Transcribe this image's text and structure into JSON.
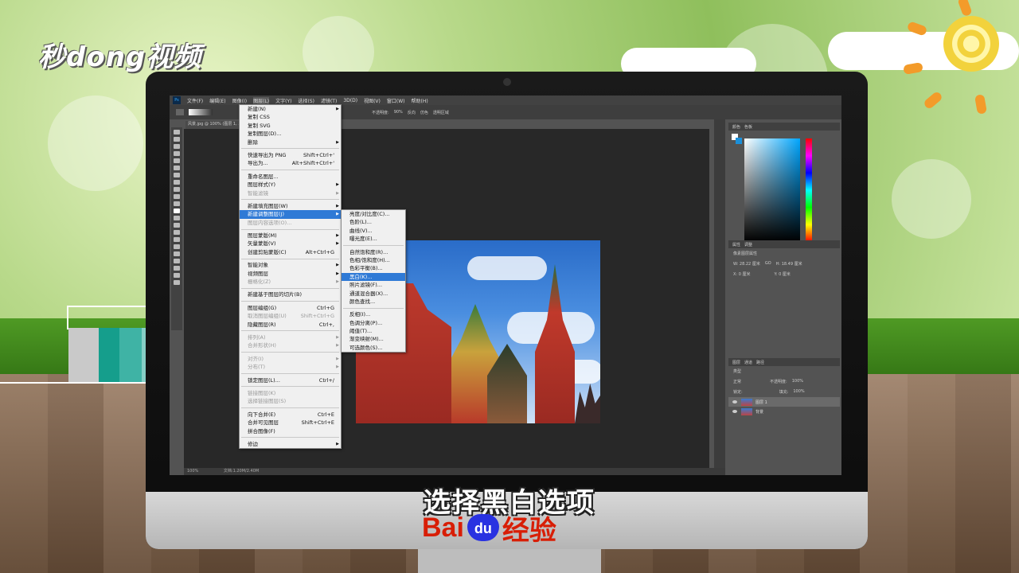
{
  "watermark": {
    "brand": "秒dong视频"
  },
  "caption": "选择黑白选项",
  "footer_logo": {
    "left": "Bai",
    "paw": "du",
    "right": "经验"
  },
  "colors": {
    "accent_blue": "#2f7ad6",
    "baidu_red": "#d81e06",
    "baidu_blue": "#2932e1",
    "teal": "#159e8c"
  },
  "ps": {
    "menubar": [
      "文件(F)",
      "编辑(E)",
      "图像(I)",
      "图层(L)",
      "文字(Y)",
      "选择(S)",
      "滤镜(T)",
      "3D(D)",
      "视图(V)",
      "窗口(W)",
      "帮助(H)"
    ],
    "options": {
      "opacity_label": "不透明度:",
      "opacity": "90%",
      "reverse": "反向",
      "dither": "仿色",
      "transparency": "透明区域"
    },
    "doc_tab": "风景.jpg @ 100% (图层 1, ...",
    "status": {
      "zoom": "100%",
      "doc": "文档:1.20M/2.40M"
    },
    "color_panel": {
      "tab1": "颜色",
      "tab2": "色板"
    },
    "props_panel": {
      "tab1": "属性",
      "tab2": "调整",
      "title": "像素图层属性",
      "w": "W: 28.22 厘米",
      "go": "GO",
      "h": "H: 18.49 厘米",
      "x": "X: 0 厘米",
      "y": "Y: 0 厘米"
    },
    "layers_panel": {
      "tabs": [
        "图层",
        "通道",
        "路径"
      ],
      "kind": "类型",
      "blend": "正常",
      "opacity_label": "不透明度:",
      "opacity": "100%",
      "lock_label": "锁定:",
      "fill_label": "填充:",
      "fill": "100%",
      "layers": [
        {
          "name": "图层 1",
          "selected": true
        },
        {
          "name": "背景",
          "selected": false
        }
      ]
    }
  },
  "layer_menu": [
    {
      "label": "新建(N)",
      "arrow": true
    },
    {
      "label": "复制 CSS"
    },
    {
      "label": "复制 SVG"
    },
    {
      "label": "复制图层(D)..."
    },
    {
      "label": "删除",
      "arrow": true
    },
    {
      "sep": true
    },
    {
      "label": "快速导出为 PNG",
      "shortcut": "Shift+Ctrl+'"
    },
    {
      "label": "导出为...",
      "shortcut": "Alt+Shift+Ctrl+'"
    },
    {
      "sep": true
    },
    {
      "label": "重命名图层..."
    },
    {
      "label": "图层样式(Y)",
      "arrow": true
    },
    {
      "label": "智能滤镜",
      "arrow": true,
      "disabled": true
    },
    {
      "sep": true
    },
    {
      "label": "新建填充图层(W)",
      "arrow": true
    },
    {
      "label": "新建调整图层(J)",
      "arrow": true,
      "highlight": true
    },
    {
      "label": "图层内容选项(O)...",
      "disabled": true
    },
    {
      "sep": true
    },
    {
      "label": "图层蒙版(M)",
      "arrow": true
    },
    {
      "label": "矢量蒙版(V)",
      "arrow": true
    },
    {
      "label": "创建剪贴蒙版(C)",
      "shortcut": "Alt+Ctrl+G"
    },
    {
      "sep": true
    },
    {
      "label": "智能对象",
      "arrow": true
    },
    {
      "label": "视频图层",
      "arrow": true
    },
    {
      "label": "栅格化(Z)",
      "arrow": true,
      "disabled": true
    },
    {
      "sep": true
    },
    {
      "label": "新建基于图层的切片(B)"
    },
    {
      "sep": true
    },
    {
      "label": "图层编组(G)",
      "shortcut": "Ctrl+G"
    },
    {
      "label": "取消图层编组(U)",
      "shortcut": "Shift+Ctrl+G",
      "disabled": true
    },
    {
      "label": "隐藏图层(R)",
      "shortcut": "Ctrl+,"
    },
    {
      "sep": true
    },
    {
      "label": "排列(A)",
      "arrow": true,
      "disabled": true
    },
    {
      "label": "合并形状(H)",
      "arrow": true,
      "disabled": true
    },
    {
      "sep": true
    },
    {
      "label": "对齐(I)",
      "arrow": true,
      "disabled": true
    },
    {
      "label": "分布(T)",
      "arrow": true,
      "disabled": true
    },
    {
      "sep": true
    },
    {
      "label": "锁定图层(L)...",
      "shortcut": "Ctrl+/"
    },
    {
      "sep": true
    },
    {
      "label": "链接图层(K)",
      "disabled": true
    },
    {
      "label": "选择链接图层(S)",
      "disabled": true
    },
    {
      "sep": true
    },
    {
      "label": "向下合并(E)",
      "shortcut": "Ctrl+E"
    },
    {
      "label": "合并可见图层",
      "shortcut": "Shift+Ctrl+E"
    },
    {
      "label": "拼合图像(F)"
    },
    {
      "sep": true
    },
    {
      "label": "修边",
      "arrow": true
    }
  ],
  "adjust_submenu": [
    {
      "label": "亮度/对比度(C)..."
    },
    {
      "label": "色阶(L)..."
    },
    {
      "label": "曲线(V)..."
    },
    {
      "label": "曝光度(E)..."
    },
    {
      "sep": true
    },
    {
      "label": "自然饱和度(R)..."
    },
    {
      "label": "色相/饱和度(H)..."
    },
    {
      "label": "色彩平衡(B)..."
    },
    {
      "label": "黑白(K)...",
      "highlight": true
    },
    {
      "label": "照片滤镜(F)..."
    },
    {
      "label": "通道混合器(X)..."
    },
    {
      "label": "颜色查找..."
    },
    {
      "sep": true
    },
    {
      "label": "反相(I)..."
    },
    {
      "label": "色调分离(P)..."
    },
    {
      "label": "阈值(T)..."
    },
    {
      "label": "渐变映射(M)..."
    },
    {
      "label": "可选颜色(S)..."
    }
  ]
}
